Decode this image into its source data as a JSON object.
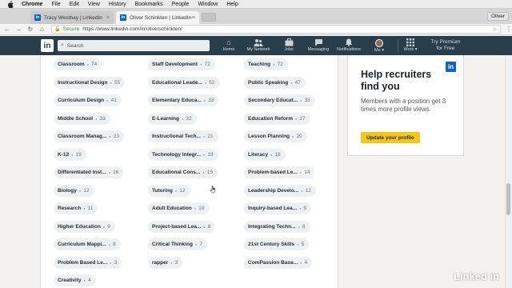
{
  "menubar": {
    "app": "Chrome",
    "items": [
      "File",
      "Edit",
      "View",
      "History",
      "Bookmarks",
      "People",
      "Window",
      "Help"
    ]
  },
  "tabs": [
    {
      "title": "Tracy Westbay | LinkedIn",
      "active": false
    },
    {
      "title": "Oliver Schinkten | LinkedIn",
      "active": true
    }
  ],
  "profile_name": "Oliver",
  "address_bar": {
    "secure_label": "Secure",
    "url": "https://www.linkedin.com/in/oliverschinkten/"
  },
  "linkedin_nav": {
    "logo": "in",
    "search_placeholder": "Search",
    "items": [
      {
        "label": "Home",
        "icon": "home-icon",
        "glyph": "⌂"
      },
      {
        "label": "My Network",
        "icon": "network-icon",
        "glyph": "👥"
      },
      {
        "label": "Jobs",
        "icon": "jobs-icon",
        "glyph": "▤"
      },
      {
        "label": "Messaging",
        "icon": "messaging-icon",
        "glyph": "✉"
      },
      {
        "label": "Notifications",
        "icon": "bell-icon",
        "glyph": "🔔"
      },
      {
        "label": "Me ▾",
        "icon": "avatar",
        "glyph": ""
      },
      {
        "label": "Work ▾",
        "icon": "grid-icon",
        "glyph": "⋮⋮⋮"
      }
    ],
    "premium_line1": "Try Premium",
    "premium_line2": "for Free"
  },
  "skills": [
    {
      "name": "Classroom",
      "count": "74"
    },
    {
      "name": "Staff Development",
      "count": "72"
    },
    {
      "name": "Teaching",
      "count": "72"
    },
    {
      "name": "Instructional Design",
      "count": "55"
    },
    {
      "name": "Educational Leade...",
      "count": "52"
    },
    {
      "name": "Public Speaking",
      "count": "47"
    },
    {
      "name": "Curriculum Design",
      "count": "41"
    },
    {
      "name": "Elementary Educa...",
      "count": "33"
    },
    {
      "name": "Secondary Educat...",
      "count": "33"
    },
    {
      "name": "Middle School",
      "count": "33"
    },
    {
      "name": "E-Learning",
      "count": "32"
    },
    {
      "name": "Education Reform",
      "count": "27"
    },
    {
      "name": "Classroom Manag...",
      "count": "23"
    },
    {
      "name": "Instructional Tech...",
      "count": "21"
    },
    {
      "name": "Lesson Planning",
      "count": "20"
    },
    {
      "name": "K-12",
      "count": "19"
    },
    {
      "name": "Technology Integr...",
      "count": "19"
    },
    {
      "name": "Literacy",
      "count": "18"
    },
    {
      "name": "Differentiated Inst...",
      "count": "16"
    },
    {
      "name": "Educational Cons...",
      "count": "15"
    },
    {
      "name": "Problem-based Le...",
      "count": "14"
    },
    {
      "name": "Biology",
      "count": "12"
    },
    {
      "name": "Tutoring",
      "count": "12"
    },
    {
      "name": "Leadership Develo...",
      "count": "12"
    },
    {
      "name": "Research",
      "count": "11"
    },
    {
      "name": "Adult Education",
      "count": "10"
    },
    {
      "name": "Inquiry-based Lea...",
      "count": "9"
    },
    {
      "name": "Higher Education",
      "count": "9"
    },
    {
      "name": "Project-based Lea...",
      "count": "8"
    },
    {
      "name": "Integrating Techn...",
      "count": "8"
    },
    {
      "name": "Curriculum Mappi...",
      "count": "8"
    },
    {
      "name": "Critical Thinking",
      "count": "7"
    },
    {
      "name": "21st Century Skills",
      "count": "5"
    },
    {
      "name": "Problem Based Le...",
      "count": "3"
    },
    {
      "name": "rapper",
      "count": "3"
    },
    {
      "name": "ComPassion Base...",
      "count": "4"
    },
    {
      "name": "Creativity",
      "count": "4"
    }
  ],
  "ad": {
    "logo": "in",
    "title": "Help recruiters find you",
    "body": "Members with a position get 3 times more profile views.",
    "button": "Update your profile",
    "button_color": "#f5c518"
  },
  "watermark": "Linked in",
  "colors": {
    "linkedin_nav": "#283e4a",
    "linkedin_blue": "#0a66c2"
  }
}
